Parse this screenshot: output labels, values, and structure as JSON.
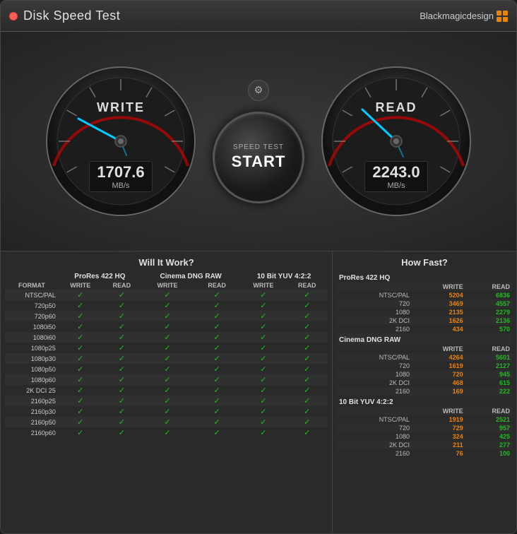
{
  "window": {
    "title": "Disk Speed Test",
    "brand": "Blackmagicdesign"
  },
  "gauges": {
    "write": {
      "label": "WRITE",
      "value": "1707.6",
      "unit": "MB/s"
    },
    "read": {
      "label": "READ",
      "value": "2243.0",
      "unit": "MB/s"
    }
  },
  "startButton": {
    "topText": "SPEED TEST",
    "mainText": "START"
  },
  "leftTable": {
    "title": "Will It Work?",
    "formats": [
      "FORMAT",
      "NTSC/PAL",
      "720p50",
      "720p60",
      "1080i50",
      "1080i60",
      "1080p25",
      "1080p30",
      "1080p50",
      "1080p60",
      "2K DCI 25",
      "2160p25",
      "2160p30",
      "2160p50",
      "2160p60"
    ],
    "groups": [
      "ProRes 422 HQ",
      "Cinema DNG RAW",
      "10 Bit YUV 4:2:2"
    ]
  },
  "rightTable": {
    "title": "How Fast?",
    "sections": [
      {
        "name": "ProRes 422 HQ",
        "rows": [
          {
            "label": "NTSC/PAL",
            "write": 5204,
            "read": 6836
          },
          {
            "label": "720",
            "write": 3469,
            "read": 4557
          },
          {
            "label": "1080",
            "write": 2135,
            "read": 2279
          },
          {
            "label": "2K DCI",
            "write": 1626,
            "read": 2136
          },
          {
            "label": "2160",
            "write": 434,
            "read": 570
          }
        ]
      },
      {
        "name": "Cinema DNG RAW",
        "rows": [
          {
            "label": "NTSC/PAL",
            "write": 4264,
            "read": 5601
          },
          {
            "label": "720",
            "write": 1619,
            "read": 2127
          },
          {
            "label": "1080",
            "write": 720,
            "read": 945
          },
          {
            "label": "2K DCI",
            "write": 468,
            "read": 615
          },
          {
            "label": "2160",
            "write": 169,
            "read": 222
          }
        ]
      },
      {
        "name": "10 Bit YUV 4:2:2",
        "rows": [
          {
            "label": "NTSC/PAL",
            "write": 1919,
            "read": 2521
          },
          {
            "label": "720",
            "write": 729,
            "read": 957
          },
          {
            "label": "1080",
            "write": 324,
            "read": 425
          },
          {
            "label": "2K DCI",
            "write": 211,
            "read": 277
          },
          {
            "label": "2160",
            "write": 76,
            "read": 100
          }
        ]
      }
    ]
  }
}
